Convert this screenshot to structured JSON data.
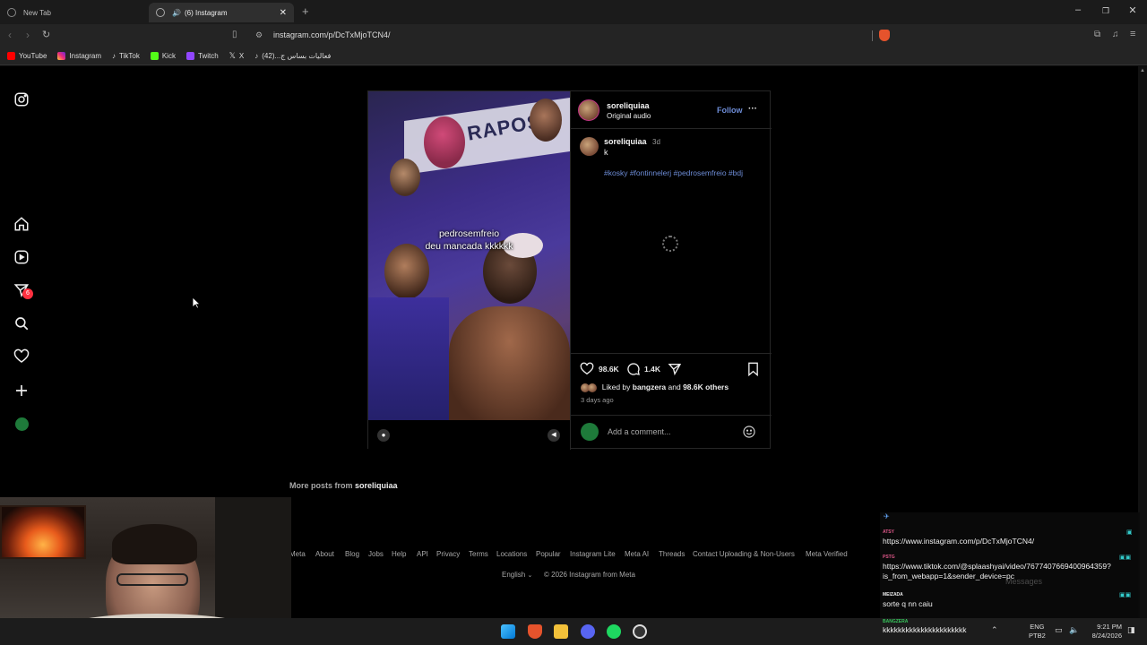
{
  "browser": {
    "tabs": [
      {
        "title": "New Tab"
      },
      {
        "title": "(6) Instagram"
      }
    ],
    "url": "instagram.com/p/DcTxMjoTCN4/",
    "bookmarks": [
      "YouTube",
      "Instagram",
      "TikTok",
      "Kick",
      "Twitch",
      "X",
      "فعاليات بساس ج...(42)"
    ]
  },
  "sidebar": {
    "items": [
      {
        "icon": "instagram-logo-icon"
      },
      {
        "icon": "home-icon"
      },
      {
        "icon": "reels-icon"
      },
      {
        "icon": "messages-icon",
        "badge": "6"
      },
      {
        "icon": "search-icon"
      },
      {
        "icon": "heart-icon"
      },
      {
        "icon": "create-icon"
      },
      {
        "icon": "profile-avatar"
      }
    ]
  },
  "post": {
    "overlay_caption_line1": "pedrosemfreio",
    "overlay_caption_line2": "deu mancada kkkkkk",
    "author": "soreliquiaa",
    "audio": "Original audio",
    "follow_label": "Follow",
    "more_label": "···",
    "comment_author": "soreliquiaa",
    "comment_time": "3d",
    "comment_text": "k",
    "hashtags": "#kosky #fontinnelerj #pedrosemfreio #bdj",
    "likes": "98.6K",
    "comments": "1.4K",
    "liked_by_prefix": "Liked by",
    "liked_by_user": "bangzera",
    "liked_by_and": "and",
    "liked_by_others": "98.6K others",
    "posted": "3 days ago",
    "comment_placeholder": "Add a comment..."
  },
  "more_posts": {
    "prefix": "More posts from",
    "user": "soreliquiaa"
  },
  "footer": {
    "links": [
      "Meta",
      "About",
      "Blog",
      "Jobs",
      "Help",
      "API",
      "Privacy",
      "Terms",
      "Locations",
      "Popular",
      "Instagram Lite",
      "Meta AI",
      "Threads",
      "Contact Uploading & Non-Users",
      "Meta Verified"
    ],
    "language": "English",
    "copyright": "© 2026 Instagram from Meta"
  },
  "chat": {
    "messages": [
      {
        "name": "ATSY",
        "text": "https://www.instagram.com/p/DcTxMjoTCN4/",
        "color": "#e0588a"
      },
      {
        "name": "PSTG",
        "text": "https://www.tiktok.com/@splaashyai/video/7677407669400964359?",
        "text2": "is_from_webapp=1&sender_device=pc",
        "color": "#e0588a"
      },
      {
        "name": "MEIZADA",
        "text": "sorte q nn caiu",
        "color": "#eeeeee"
      },
      {
        "name": "BANGZERA",
        "text": "kkkkkkkkkkkkkkkkkkkkkk",
        "color": "#37c45b"
      }
    ],
    "ghost_label": "Messages"
  },
  "taskbar": {
    "lang1": "ENG",
    "lang2": "PTB2",
    "time": "9:21 PM",
    "date": "8/24/2026"
  },
  "colors": {
    "accent_blue": "#6d8cd6",
    "badge_red": "#ff3040",
    "avatar_green": "#1e7a3a"
  }
}
